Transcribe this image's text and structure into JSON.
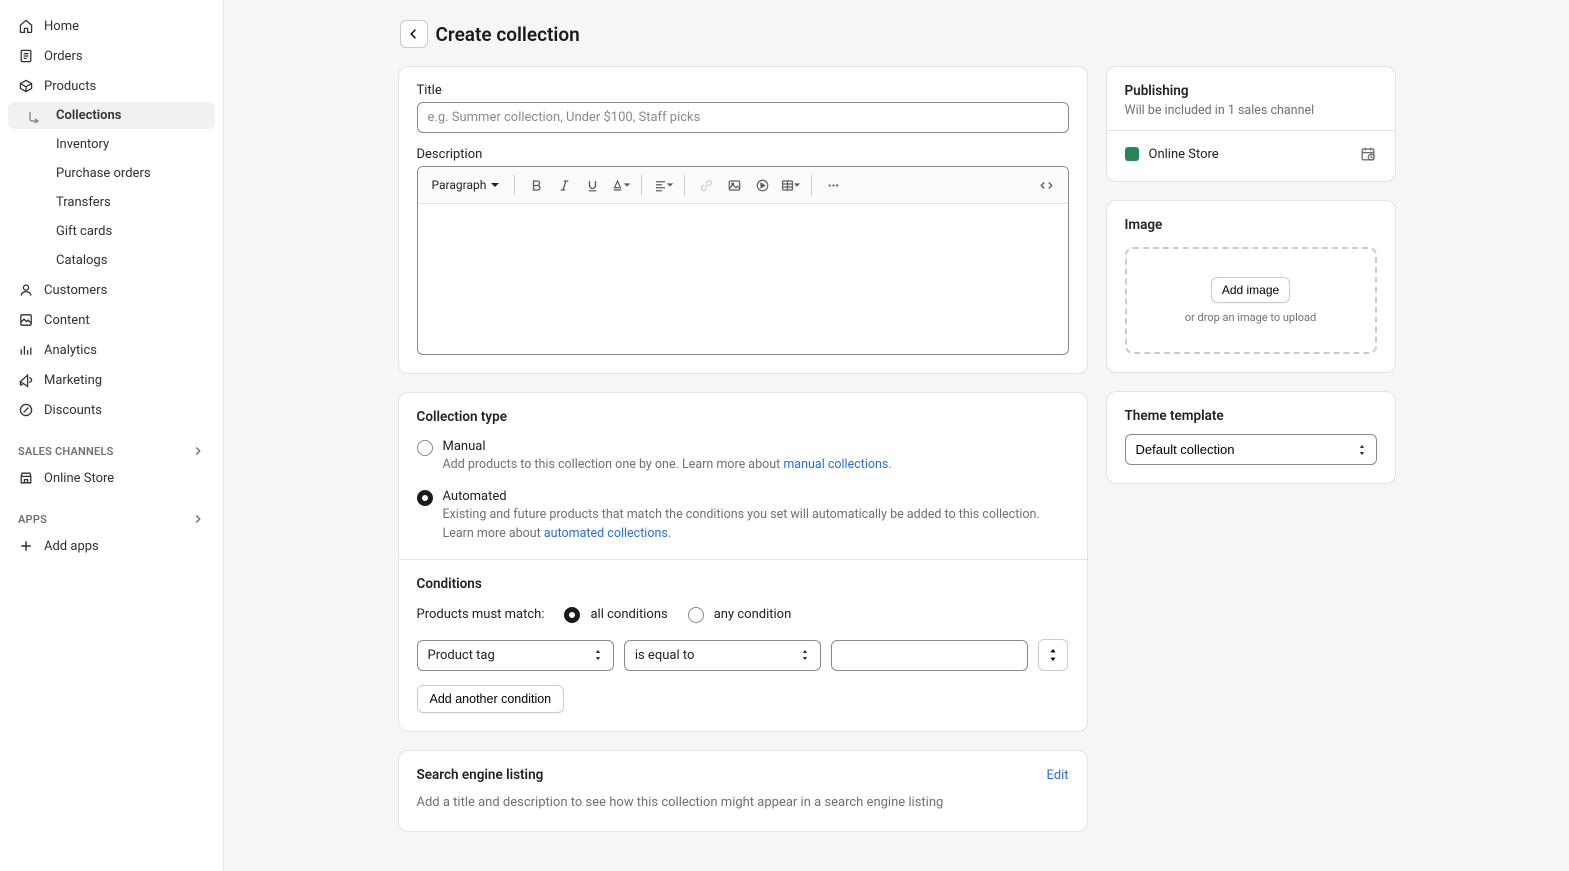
{
  "page": {
    "title": "Create collection"
  },
  "sidebar": {
    "items": [
      {
        "label": "Home",
        "icon": "home-icon"
      },
      {
        "label": "Orders",
        "icon": "orders-icon"
      },
      {
        "label": "Products",
        "icon": "products-icon"
      },
      {
        "label": "Collections",
        "child": true,
        "active": true
      },
      {
        "label": "Inventory",
        "child": true
      },
      {
        "label": "Purchase orders",
        "child": true
      },
      {
        "label": "Transfers",
        "child": true
      },
      {
        "label": "Gift cards",
        "child": true
      },
      {
        "label": "Catalogs",
        "child": true
      },
      {
        "label": "Customers",
        "icon": "customers-icon"
      },
      {
        "label": "Content",
        "icon": "content-icon"
      },
      {
        "label": "Analytics",
        "icon": "analytics-icon"
      },
      {
        "label": "Marketing",
        "icon": "marketing-icon"
      },
      {
        "label": "Discounts",
        "icon": "discounts-icon"
      }
    ],
    "sections": {
      "sales_channels": "Sales channels",
      "apps": "Apps"
    },
    "online_store": "Online Store",
    "add_apps": "Add apps"
  },
  "title_card": {
    "title_label": "Title",
    "title_placeholder": "e.g. Summer collection, Under $100, Staff picks",
    "title_value": "",
    "desc_label": "Description",
    "paragraph_label": "Paragraph"
  },
  "collection_type": {
    "heading": "Collection type",
    "manual_label": "Manual",
    "manual_help_pre": "Add products to this collection one by one. Learn more about ",
    "manual_help_link": "manual collections",
    "auto_label": "Automated",
    "auto_help_pre": "Existing and future products that match the conditions you set will automatically be added to this collection. Learn more about ",
    "auto_help_link": "automated collections",
    "conditions_heading": "Conditions",
    "match_label": "Products must match:",
    "match_all": "all conditions",
    "match_any": "any condition",
    "field_select": "Product tag",
    "op_select": "is equal to",
    "value": "",
    "add_condition": "Add another condition"
  },
  "seo": {
    "heading": "Search engine listing",
    "edit": "Edit",
    "help": "Add a title and description to see how this collection might appear in a search engine listing"
  },
  "publishing": {
    "heading": "Publishing",
    "sub": "Will be included in 1 sales channel",
    "channel": "Online Store"
  },
  "image": {
    "heading": "Image",
    "button": "Add image",
    "help": "or drop an image to upload"
  },
  "theme": {
    "heading": "Theme template",
    "value": "Default collection"
  }
}
